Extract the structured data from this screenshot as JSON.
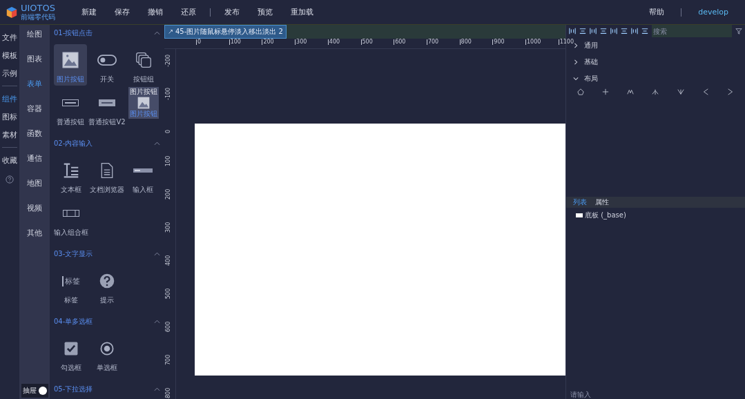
{
  "logo": {
    "title": "UIOTOS",
    "subtitle": "前端零代码"
  },
  "menu": [
    {
      "label": "新建"
    },
    {
      "label": "保存"
    },
    {
      "label": "撤销"
    },
    {
      "label": "还原"
    },
    {
      "label": "发布",
      "divider_before": true
    },
    {
      "label": "预览"
    },
    {
      "label": "重加载"
    }
  ],
  "header_right": {
    "help": "帮助",
    "user": "develop"
  },
  "nav": [
    {
      "label": "文件",
      "selected": false
    },
    {
      "label": "模板",
      "selected": false
    },
    {
      "label": "示例",
      "selected": false,
      "divider_after": true
    },
    {
      "label": "组件",
      "selected": true
    },
    {
      "label": "图标",
      "selected": false
    },
    {
      "label": "素材",
      "selected": false,
      "divider_after": true
    },
    {
      "label": "收藏",
      "selected": false
    }
  ],
  "categories": [
    {
      "label": "绘图",
      "selected": false
    },
    {
      "label": "图表",
      "selected": false
    },
    {
      "label": "表单",
      "selected": true
    },
    {
      "label": "容器",
      "selected": false
    },
    {
      "label": "函数",
      "selected": false
    },
    {
      "label": "通信",
      "selected": false
    },
    {
      "label": "地图",
      "selected": false
    },
    {
      "label": "视频",
      "selected": false
    },
    {
      "label": "其他",
      "selected": false
    }
  ],
  "drawer": {
    "label": "抽屉",
    "on": true
  },
  "sections": [
    {
      "title": "01-按钮点击",
      "expanded": true,
      "items": [
        {
          "label": "图片按钮",
          "kind": "image",
          "selected": true
        },
        {
          "label": "开关",
          "kind": "switch",
          "selected": false
        },
        {
          "label": "按钮组",
          "kind": "group",
          "selected": false
        },
        {
          "label": "普通按钮",
          "kind": "button",
          "selected": false
        },
        {
          "label": "普通按钮V2",
          "kind": "button2",
          "selected": false
        }
      ]
    },
    {
      "title": "02-内容输入",
      "expanded": true,
      "items": [
        {
          "label": "文本框",
          "kind": "textbox",
          "selected": false
        },
        {
          "label": "文档浏览器",
          "kind": "document",
          "selected": false
        },
        {
          "label": "输入框",
          "kind": "input",
          "selected": false
        },
        {
          "label": "输入组合框",
          "kind": "inputgroup",
          "selected": false
        }
      ]
    },
    {
      "title": "03-文字显示",
      "expanded": true,
      "items": [
        {
          "label": "标签",
          "kind": "label",
          "selected": false,
          "preview": "标签"
        },
        {
          "label": "提示",
          "kind": "help",
          "selected": false
        }
      ]
    },
    {
      "title": "04-单多选框",
      "expanded": true,
      "items": [
        {
          "label": "勾选框",
          "kind": "checkbox",
          "selected": false
        },
        {
          "label": "单选框",
          "kind": "radio",
          "selected": false
        }
      ]
    },
    {
      "title": "05-下拉选择",
      "expanded": true
    }
  ],
  "drag_preview": {
    "tooltip": "图片按钮",
    "label": "图片按钮"
  },
  "canvas": {
    "tab": "45-图片随鼠标悬停淡入移出淡出 2",
    "hticks": [
      "0",
      "100",
      "200",
      "300",
      "400",
      "500",
      "600",
      "700",
      "800",
      "900",
      "1000",
      "1100"
    ],
    "vticks": [
      "-200",
      "-100",
      "0",
      "100",
      "200",
      "300",
      "400",
      "500",
      "600",
      "700",
      "800"
    ]
  },
  "toolbar": {
    "search_placeholder": "搜索"
  },
  "palette": [
    {
      "label": "通用",
      "expanded": false
    },
    {
      "label": "基础",
      "expanded": false
    },
    {
      "label": "布局",
      "expanded": true
    }
  ],
  "layers": {
    "tabs": [
      {
        "label": "列表",
        "selected": true
      },
      {
        "label": "属性",
        "selected": false
      }
    ],
    "rows": [
      {
        "label": "底板 (_base)"
      }
    ],
    "placeholder": "请输入"
  }
}
